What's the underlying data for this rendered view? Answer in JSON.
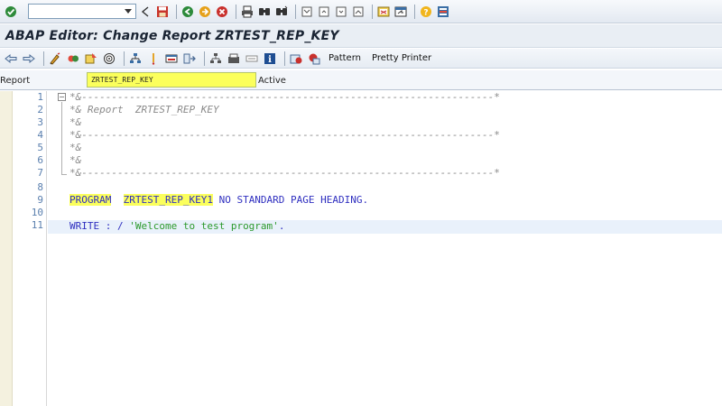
{
  "system_toolbar": {
    "command_field_value": "",
    "icons": [
      "enter-icon",
      "back-icon",
      "save-icon",
      "back-nav-icon",
      "exit-icon",
      "cancel-icon",
      "print-icon",
      "find-icon",
      "find-next-icon",
      "first-page-icon",
      "prev-page-icon",
      "next-page-icon",
      "last-page-icon",
      "new-session-icon",
      "shortcut-icon",
      "help-icon",
      "layout-menu-icon"
    ]
  },
  "title": "ABAP Editor: Change Report ZRTEST_REP_KEY",
  "app_toolbar": {
    "pattern_label": "Pattern",
    "pretty_printer_label": "Pretty Printer"
  },
  "report_row": {
    "label": "Report",
    "name": "ZRTEST_REP_KEY",
    "status": "Active"
  },
  "editor": {
    "line_numbers": [
      "1",
      "2",
      "3",
      "4",
      "5",
      "6",
      "7",
      "8",
      "9",
      "10",
      "11"
    ],
    "lines": {
      "l1": "*&---------------------------------------------------------------------*",
      "l2": "*& Report  ZRTEST_REP_KEY",
      "l3": "*&",
      "l4": "*&---------------------------------------------------------------------*",
      "l5": "*&",
      "l6": "*&",
      "l7": "*&---------------------------------------------------------------------*",
      "l9_kw": "PROGRAM",
      "l9_name": "ZRTEST_REP_KEY1",
      "l9_rest": " NO STANDARD PAGE HEADING.",
      "l11_kw": "WRITE : / ",
      "l11_str": "'Welcome to test program'",
      "l11_end": "."
    }
  },
  "colors": {
    "highlight": "#fbff5c",
    "keyword": "#3030c0",
    "string": "#2d9a2d",
    "comment": "#8a8a8a",
    "line_number": "#5a7fae"
  }
}
